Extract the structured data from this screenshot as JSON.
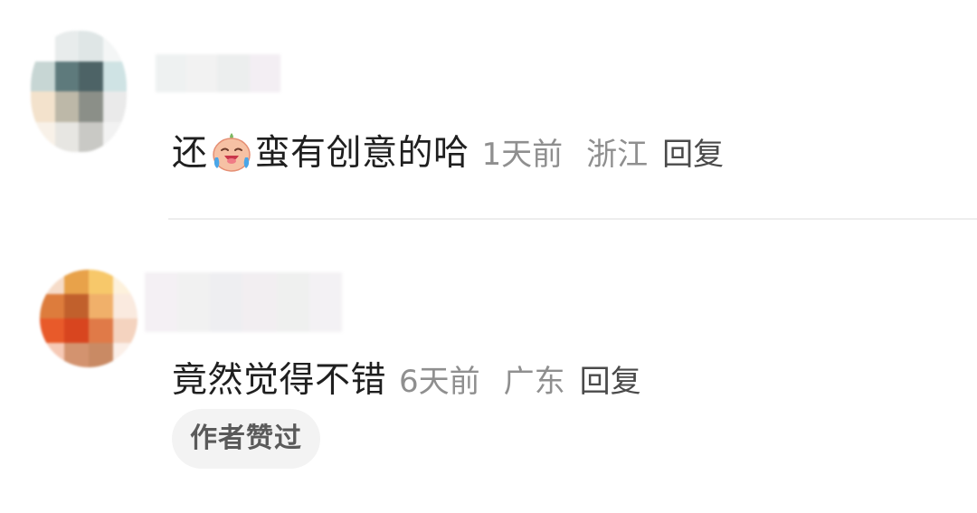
{
  "comments": [
    {
      "text_before": "还",
      "emoji": "crying-laughing-face-icon",
      "text_after": "蛮有创意的哈",
      "time": "1天前",
      "location": "浙江",
      "reply_label": "回复"
    },
    {
      "text": "竟然觉得不错",
      "time": "6天前",
      "location": "广东",
      "reply_label": "回复",
      "badge": "作者赞过"
    }
  ],
  "colors": {
    "text": "#1f1f1f",
    "meta": "#8f8f8f",
    "badge_bg": "#f3f3f3",
    "divider": "#ededed"
  }
}
